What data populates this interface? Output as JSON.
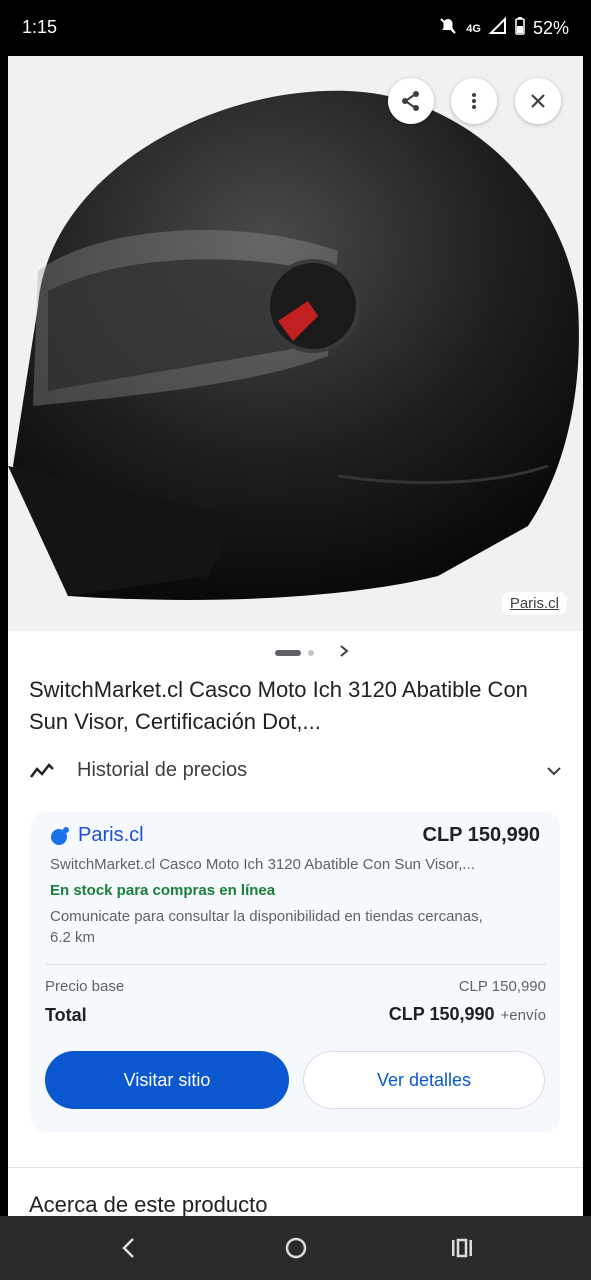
{
  "status_bar": {
    "time": "1:15",
    "network": "4G",
    "battery": "52%"
  },
  "hero": {
    "source_label": "Paris.cl",
    "image_description_icon": "motorcycle-helmet-image"
  },
  "product": {
    "title": "SwitchMarket.cl Casco Moto Ich 3120 Abatible Con Sun Visor, Certificación Dot,..."
  },
  "price_history": {
    "label": "Historial de precios"
  },
  "offer": {
    "merchant": "Paris.cl",
    "price": "CLP 150,990",
    "description": "SwitchMarket.cl Casco Moto Ich 3120 Abatible Con Sun Visor,...",
    "stock": "En stock para compras en línea",
    "availability_note": "Comunicate para consultar la disponibilidad en tiendas cercanas, 6.2 km",
    "base_price_label": "Precio base",
    "base_price_value": "CLP 150,990",
    "total_label": "Total",
    "total_value": "CLP 150,990",
    "shipping_note": "+envío",
    "visit_button": "Visitar sitio",
    "details_button": "Ver detalles"
  },
  "about": {
    "heading": "Acerca de este producto"
  },
  "colors": {
    "primary": "#0b57d0",
    "merchant_dot": "#1a73e8",
    "stock_green": "#188038"
  }
}
